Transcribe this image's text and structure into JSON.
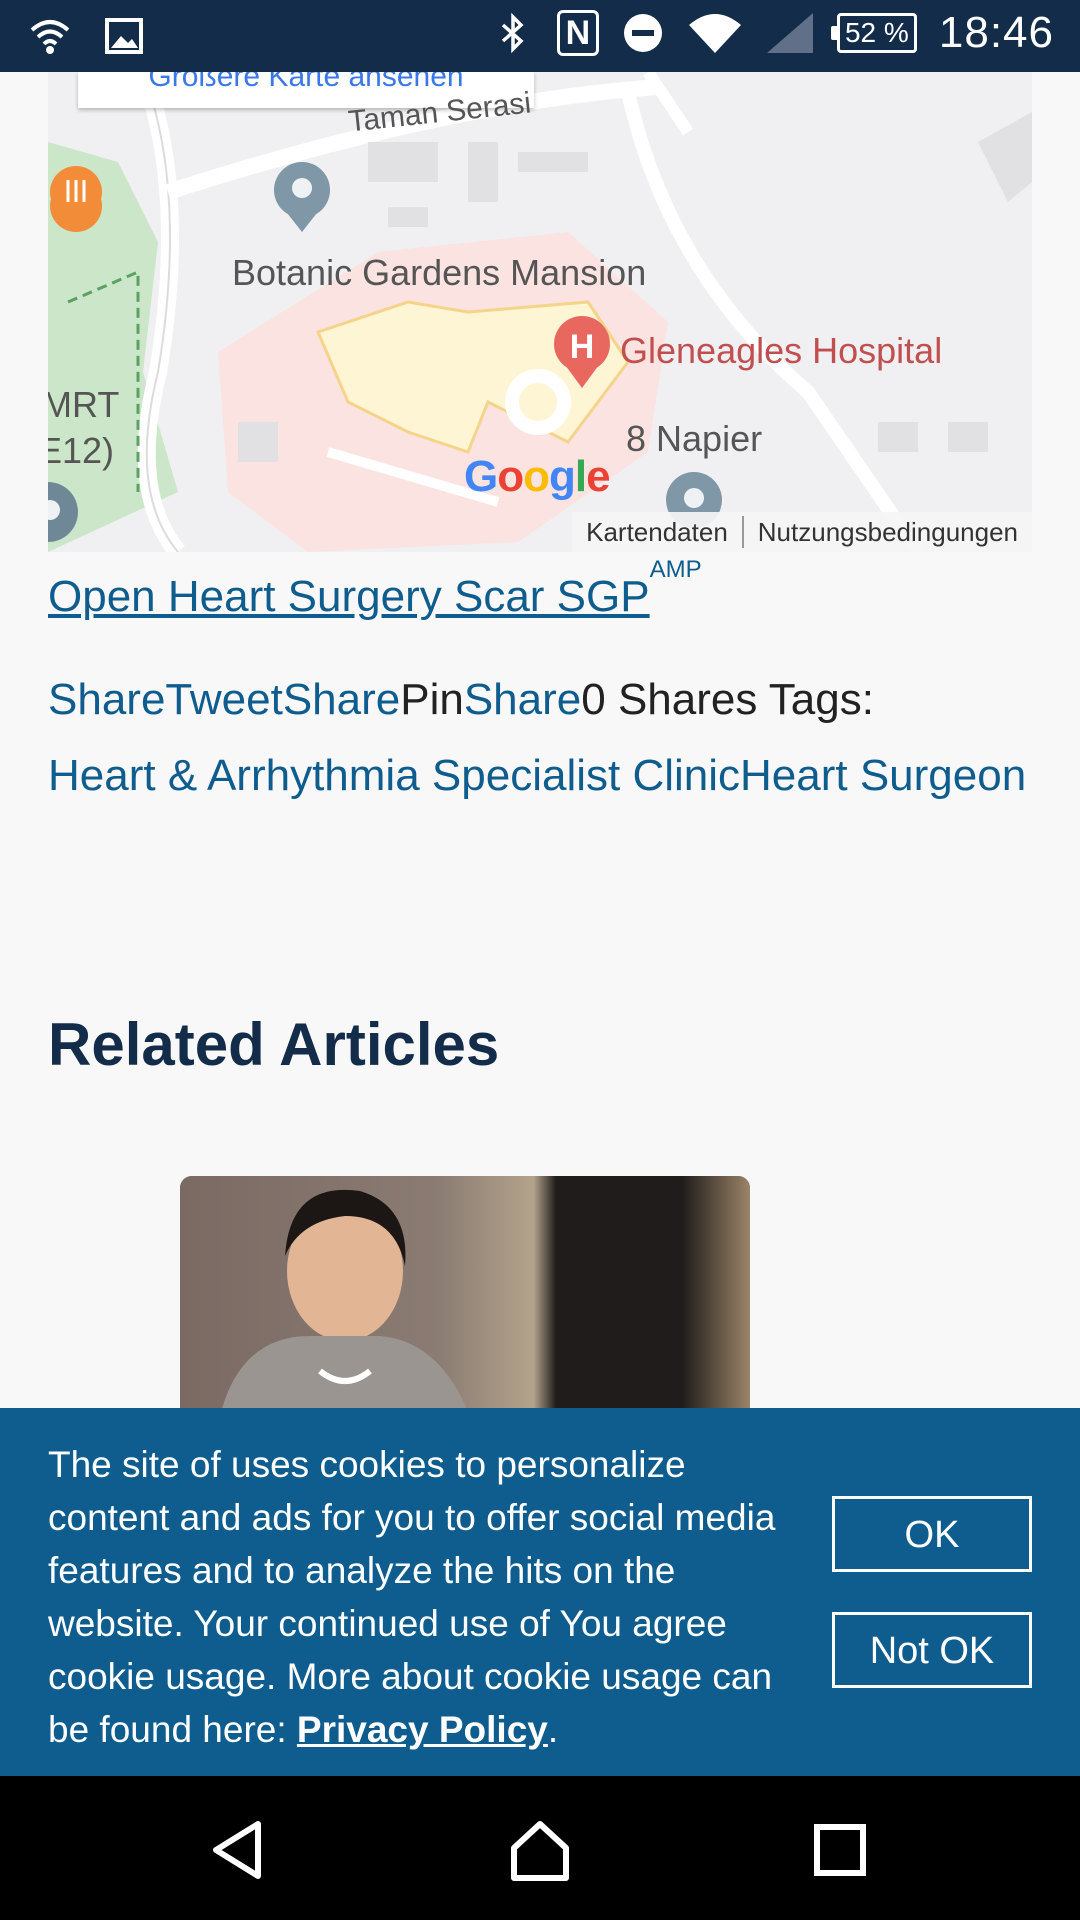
{
  "status_bar": {
    "time": "18:46",
    "battery": "52 %",
    "icons": [
      "wifi-hotspot-icon",
      "image-icon",
      "bluetooth-icon",
      "nfc-icon",
      "do-not-disturb-icon",
      "wifi-icon",
      "signal-icon",
      "battery-icon"
    ],
    "nfc_letter": "N"
  },
  "map": {
    "larger_map_link": "Größere Karte ansehen",
    "labels": {
      "street": "Taman Serasi",
      "poi_mansion": "Botanic Gardens Mansion",
      "poi_hospital": "Gleneagles Hospital",
      "poi_napier": "8 Napier",
      "mrt": "MRT",
      "mrt_code": "E12)"
    },
    "google_logo": "Google",
    "map_data_label": "Kartendaten",
    "terms_label": "Nutzungsbedingungen",
    "colors": {
      "hospital_marker": "#e8685f",
      "poi_marker": "#78909c",
      "restaurant_marker": "#f28c38",
      "park": "#c8e6c9"
    }
  },
  "article": {
    "link_text": "Open Heart Surgery Scar SGP",
    "link_superscript": "AMP",
    "share_items": [
      {
        "label": "Share",
        "type": "link"
      },
      {
        "label": "Tweet",
        "type": "link"
      },
      {
        "label": "Share",
        "type": "link"
      },
      {
        "label": "Pin",
        "type": "text"
      },
      {
        "label": "Share",
        "type": "link"
      }
    ],
    "shares_count": "0 Shares",
    "tags_label": "Tags:",
    "tags": [
      "Heart & Arrhythmia Specialist Clinic",
      "Heart Surgeon"
    ]
  },
  "related": {
    "heading": "Related Articles"
  },
  "cookie_banner": {
    "text": "The site of uses cookies to personalize content and ads for you to offer social media features and to analyze the hits on the website. Your continued use of You agree cookie usage. More about cookie usage can be found here: ",
    "policy_link": "Privacy Policy",
    "trailing": ".",
    "ok_label": "OK",
    "not_ok_label": "Not OK"
  },
  "nav_bar": {
    "buttons": [
      "back-icon",
      "home-icon",
      "recents-icon"
    ]
  }
}
